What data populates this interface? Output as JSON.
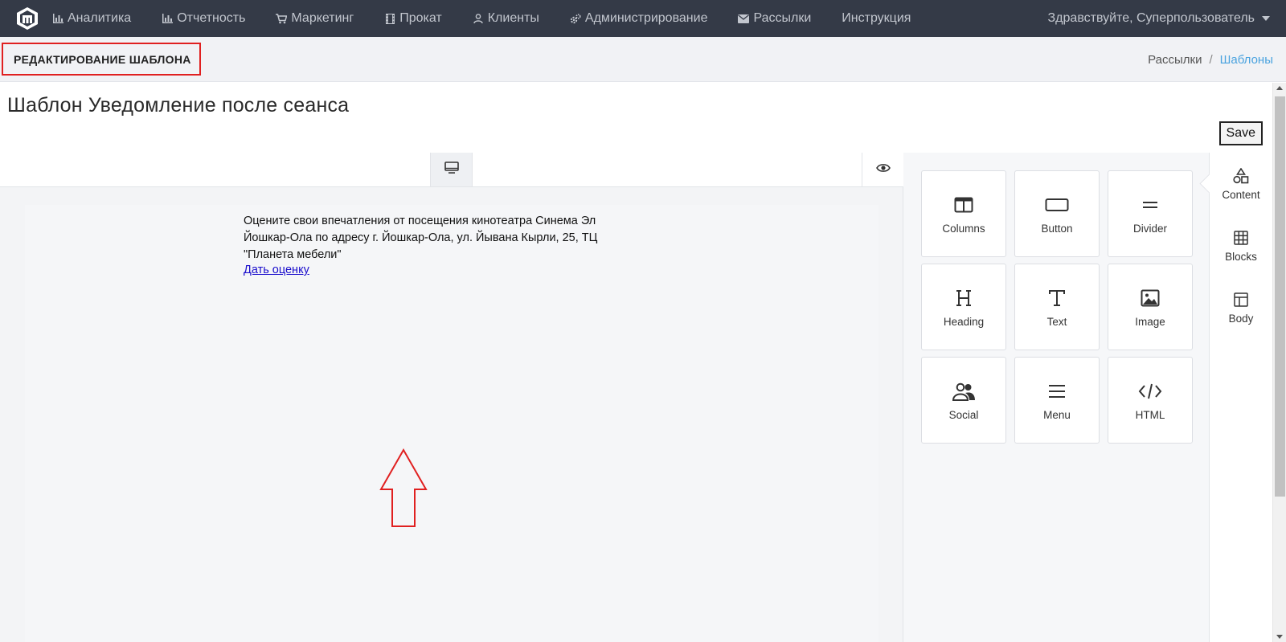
{
  "nav": {
    "items": [
      {
        "label": "Аналитика",
        "icon": "bar-chart-icon"
      },
      {
        "label": "Отчетность",
        "icon": "bar-chart-icon"
      },
      {
        "label": "Маркетинг",
        "icon": "cart-icon"
      },
      {
        "label": "Прокат",
        "icon": "film-icon"
      },
      {
        "label": "Клиенты",
        "icon": "user-icon"
      },
      {
        "label": "Администрирование",
        "icon": "gears-icon"
      },
      {
        "label": "Рассылки",
        "icon": "envelope-icon"
      },
      {
        "label": "Инструкция",
        "icon": ""
      }
    ],
    "greeting": "Здравствуйте, Суперпользователь"
  },
  "subheader": {
    "title": "РЕДАКТИРОВАНИЕ ШАБЛОНА",
    "breadcrumb": {
      "parent": "Рассылки",
      "separator": "/",
      "current": "Шаблоны"
    }
  },
  "main": {
    "template_title": "Шаблон Уведомление после сеанса",
    "save_label": "Save"
  },
  "email": {
    "text": "Оцените свои впечатления от посещения кинотеатра Синема Эл Йошкар-Ола по адресу г. Йошкар-Ола, ул. Йывана Кырли, 25, ТЦ \"Планета мебели\"",
    "link": "Дать оценку"
  },
  "tools": [
    {
      "label": "Columns",
      "icon": "columns-icon"
    },
    {
      "label": "Button",
      "icon": "button-icon"
    },
    {
      "label": "Divider",
      "icon": "divider-icon"
    },
    {
      "label": "Heading",
      "icon": "heading-icon"
    },
    {
      "label": "Text",
      "icon": "text-icon"
    },
    {
      "label": "Image",
      "icon": "image-icon"
    },
    {
      "label": "Social",
      "icon": "social-icon"
    },
    {
      "label": "Menu",
      "icon": "menu-icon"
    },
    {
      "label": "HTML",
      "icon": "code-icon"
    }
  ],
  "side_tabs": [
    {
      "label": "Content",
      "icon": "shapes-icon",
      "active": true
    },
    {
      "label": "Blocks",
      "icon": "blocks-icon",
      "active": false
    },
    {
      "label": "Body",
      "icon": "layout-icon",
      "active": false
    }
  ],
  "colors": {
    "nav_bg": "#343a47",
    "highlight_border": "#e02020",
    "breadcrumb_active": "#4aa3df",
    "link": "#1a0dcc",
    "arrow": "#e02020"
  }
}
